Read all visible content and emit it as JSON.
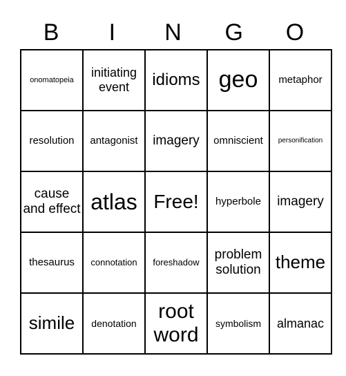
{
  "header": [
    "B",
    "I",
    "N",
    "G",
    "O"
  ],
  "cells": [
    [
      "onomatopeia",
      "initiating event",
      "idioms",
      "geo",
      "metaphor"
    ],
    [
      "resolution",
      "antagonist",
      "imagery",
      "omniscient",
      "personification"
    ],
    [
      "cause and effect",
      "atlas",
      "Free!",
      "hyperbole",
      "imagery"
    ],
    [
      "thesaurus",
      "connotation",
      "foreshadow",
      "problem solution",
      "theme"
    ],
    [
      "simile",
      "denotation",
      "root word",
      "symbolism",
      "almanac"
    ]
  ]
}
